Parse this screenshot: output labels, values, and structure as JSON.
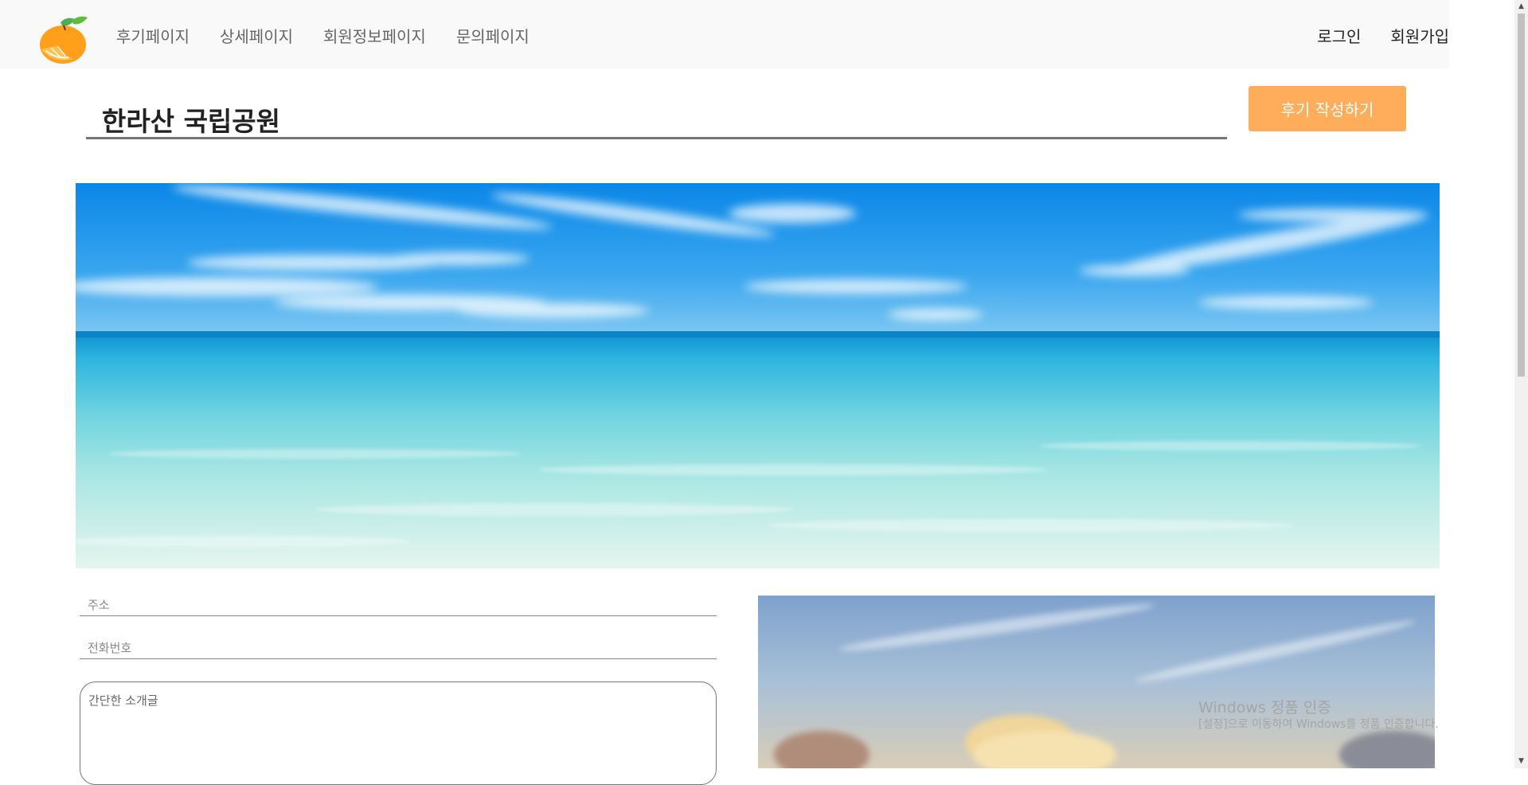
{
  "nav": {
    "items": [
      {
        "label": "후기페이지"
      },
      {
        "label": "상세페이지"
      },
      {
        "label": "회원정보페이지"
      },
      {
        "label": "문의페이지"
      }
    ],
    "login_label": "로그인",
    "signup_label": "회원가입"
  },
  "place": {
    "title": "한라산 국립공원",
    "write_review_label": "후기 작성하기"
  },
  "form": {
    "address_placeholder": "주소",
    "phone_placeholder": "전화번호",
    "intro_placeholder": "간단한 소개글"
  },
  "watermark": {
    "title": "Windows 정품 인증",
    "subtitle": "[설정]으로 이동하여 Windows를 정품 인증합니다."
  },
  "icons": {
    "logo": "orange-fruit-icon",
    "scroll_up": "chevron-up-icon",
    "scroll_down": "chevron-down-icon"
  },
  "colors": {
    "accent": "#ffad5a",
    "header_bg": "#f9f9f9",
    "sea_blue": "#0096e6",
    "turquoise": "#5fd3dc"
  }
}
